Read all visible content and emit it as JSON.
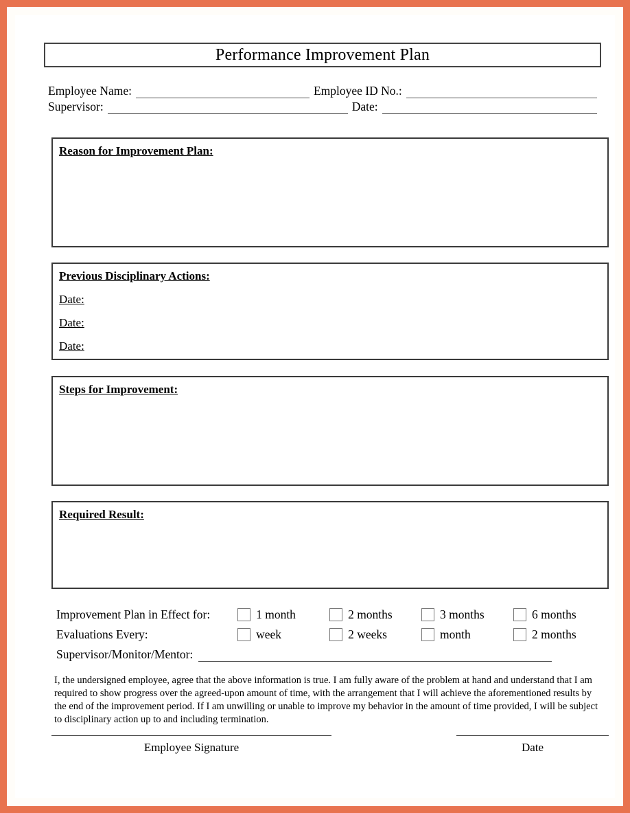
{
  "document": {
    "title": "Performance Improvement Plan",
    "border_color": "#e8734f",
    "page_background": "#ffffff"
  },
  "identity": {
    "employee_name_label": "Employee Name:",
    "employee_id_label": "Employee ID No.:",
    "supervisor_label": "Supervisor:",
    "date_label": "Date:",
    "employee_name_value": "",
    "employee_id_value": "",
    "supervisor_value": "",
    "date_value": ""
  },
  "sections": {
    "reason": {
      "title": "Reason for Improvement Plan:",
      "body": ""
    },
    "previous_actions": {
      "title": "Previous Disciplinary Actions:",
      "date_label_1": "Date:",
      "date_label_2": "Date:",
      "date_label_3": "Date:",
      "date_value_1": "",
      "date_value_2": "",
      "date_value_3": ""
    },
    "steps": {
      "title": "Steps for Improvement:",
      "body": ""
    },
    "required_result": {
      "title": "Required Result:",
      "body": ""
    }
  },
  "duration": {
    "row_label": "Improvement Plan in Effect for:",
    "options": [
      {
        "label": "1 month",
        "checked": false
      },
      {
        "label": "2 months",
        "checked": false
      },
      {
        "label": "3 months",
        "checked": false
      },
      {
        "label": "6 months",
        "checked": false
      }
    ]
  },
  "evaluation": {
    "row_label": "Evaluations Every:",
    "options": [
      {
        "label": "week",
        "checked": false
      },
      {
        "label": "2 weeks",
        "checked": false
      },
      {
        "label": "month",
        "checked": false
      },
      {
        "label": "2 months",
        "checked": false
      }
    ]
  },
  "supervisor_mentor": {
    "label": "Supervisor/Monitor/Mentor:",
    "value": ""
  },
  "agreement": {
    "text": "I, the undersigned employee, agree that the above information is true. I am fully aware of the problem at hand and understand that I am required to show progress over the agreed-upon amount of time, with the arrangement that I will achieve the aforementioned results by the end of the improvement period. If I am unwilling or unable to improve my behavior in the amount of time provided, I will be subject to disciplinary action up to and including termination."
  },
  "signature": {
    "employee_signature_label": "Employee Signature",
    "date_label": "Date",
    "employee_signature_value": "",
    "date_value": ""
  }
}
